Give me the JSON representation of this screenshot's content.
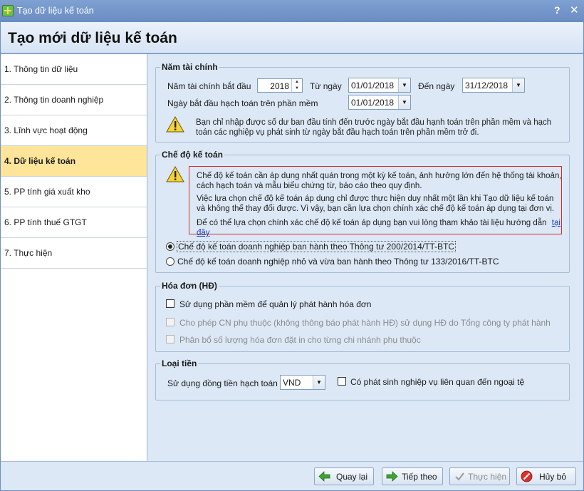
{
  "window": {
    "title": "Tạo dữ liệu kế toán",
    "help": "?",
    "close": "✕"
  },
  "header": {
    "title": "Tạo mới dữ liệu kế toán"
  },
  "sidebar": {
    "items": [
      {
        "label": "1. Thông tin dữ liệu"
      },
      {
        "label": "2. Thông tin doanh nghiệp"
      },
      {
        "label": "3. Lĩnh vực hoạt động"
      },
      {
        "label": "4. Dữ liệu kế toán"
      },
      {
        "label": "5. PP tính giá xuất kho"
      },
      {
        "label": "6. PP tính thuế GTGT"
      },
      {
        "label": "7. Thực hiện"
      }
    ]
  },
  "fiscal": {
    "legend": "Năm tài chính",
    "start_year_label": "Năm tài chính bắt đầu",
    "start_year": "2018",
    "from_label": "Từ ngày",
    "from_date": "01/01/2018",
    "to_label": "Đến ngày",
    "to_date": "31/12/2018",
    "begin_label": "Ngày bắt đầu hạch toán trên phần mềm",
    "begin_date": "01/01/2018",
    "note_line1": "Bạn chỉ nhập được số dư ban đầu tính đến trước ngày bắt đầu hạnh toán trên phần mềm và hạch",
    "note_line2": "toán các nghiệp vụ phát sinh từ ngày bắt đầu hạch toán trên phần mềm trở đi."
  },
  "regime": {
    "legend": "Chế độ kế toán",
    "p1_line1": "Chế độ kế toán cần áp dụng nhất quán trong một kỳ kế toán, ảnh hưởng lớn đến hệ thống tài khoản,",
    "p1_line2": "cách hạch toán và mẫu biểu chứng từ, báo cáo theo quy định.",
    "p2_line1": "Việc lựa chọn chế độ kế toán áp dụng chỉ được thực hiện duy nhất một lần khi Tạo dữ liệu kế toán",
    "p2_line2": "và không thể thay đổi được. Vì vậy, bạn cần lựa chọn chính xác chế độ kế toán áp dụng tại đơn vị.",
    "p3_text": "Để có thể lựa chọn chính xác chế độ kế toán áp dụng bạn vui lòng tham khảo tài liệu hướng dẫn",
    "p3_link": "tại đây",
    "option1": "Chế độ kế toán doanh nghiệp ban hành theo Thông tư 200/2014/TT-BTC",
    "option2": "Chế độ kế toán doanh nghiệp nhỏ và vừa ban hành theo Thông tư 133/2016/TT-BTC"
  },
  "invoice": {
    "legend": "Hóa đơn (HĐ)",
    "cb1": "Sử dụng phần mềm để quản lý phát hành hóa đơn",
    "cb2": "Cho phép CN phụ thuộc (không thông báo phát hành HĐ) sử dụng HĐ do Tổng công ty phát hành",
    "cb3": "Phân bổ số lượng hóa đơn đặt in cho từng chi nhánh phụ thuộc"
  },
  "currency": {
    "legend": "Loại tiền",
    "label": "Sử dụng đồng tiền hạch toán",
    "value": "VND",
    "cb_foreign": "Có phát sinh nghiệp vụ liên quan đến ngoại tệ"
  },
  "footer": {
    "back": "Quay lại",
    "next": "Tiếp theo",
    "execute": "Thực hiện",
    "cancel": "Hủy bỏ"
  },
  "colors": {
    "accent": "#6d8fc2",
    "active_item": "#ffe59a",
    "panel": "#dce8f6",
    "warning_border": "#d42a2a"
  }
}
